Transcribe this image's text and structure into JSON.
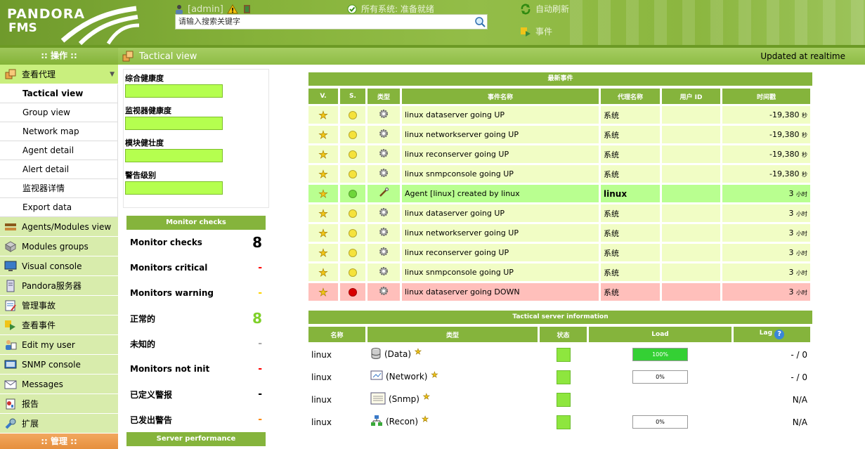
{
  "header": {
    "logo_line1": "PANDORA",
    "logo_line2": "FMS",
    "username": "[admin]",
    "search_placeholder": "请输入搜索关键字",
    "system_status": "所有系统: 准备就绪",
    "auto_refresh": "自动刷新",
    "events": "事件"
  },
  "sidebar": {
    "operation_header": ":: 操作 ::",
    "admin_header": ":: 管理 ::",
    "agents_item": "查看代理",
    "sub_items": [
      "Tactical view",
      "Group view",
      "Network map",
      "Agent detail",
      "Alert detail",
      "监视器详情",
      "Export data"
    ],
    "items": [
      {
        "label": "Agents/Modules view",
        "icon": "agents-modules-icon"
      },
      {
        "label": "Modules groups",
        "icon": "modules-groups-icon"
      },
      {
        "label": "Visual console",
        "icon": "visual-console-icon"
      },
      {
        "label": "Pandora服务器",
        "icon": "server-icon"
      },
      {
        "label": "管理事故",
        "icon": "incidents-icon"
      },
      {
        "label": "查看事件",
        "icon": "events-icon"
      },
      {
        "label": "Edit my user",
        "icon": "user-edit-icon"
      },
      {
        "label": "SNMP console",
        "icon": "snmp-icon"
      },
      {
        "label": "Messages",
        "icon": "mail-icon"
      },
      {
        "label": "报告",
        "icon": "report-icon"
      },
      {
        "label": "扩展",
        "icon": "extensions-icon"
      }
    ]
  },
  "titlebar": {
    "title": "Tactical view",
    "updated": "Updated at realtime"
  },
  "health": {
    "labels": [
      "综合健康度",
      "监视器健康度",
      "模块健壮度",
      "警告级别"
    ]
  },
  "monitors": {
    "title": "Monitor checks",
    "server_performance": "Server performance",
    "rows": [
      {
        "label": "Monitor checks",
        "value": "8",
        "color": "#000000"
      },
      {
        "label": "Monitors critical",
        "value": "-",
        "color": "#ff0000"
      },
      {
        "label": "Monitors warning",
        "value": "-",
        "color": "#ffd400"
      },
      {
        "label": "正常的",
        "value": "8",
        "color": "#7fd02a"
      },
      {
        "label": "未知的",
        "value": "-",
        "color": "#aaaaaa"
      },
      {
        "label": "Monitors not init",
        "value": "-",
        "color": "#ff0000"
      },
      {
        "label": "已定义警报",
        "value": "-",
        "color": "#000000"
      },
      {
        "label": "已发出警告",
        "value": "-",
        "color": "#ff8a00"
      }
    ]
  },
  "events": {
    "title": "最新事件",
    "columns": [
      "V.",
      "S.",
      "类型",
      "事件名称",
      "代理名称",
      "用户 ID",
      "时间戳"
    ],
    "rows": [
      {
        "status": "warn",
        "dot": "#f5e23b",
        "type": "gear",
        "name": "linux dataserver going UP",
        "agent": "系统",
        "user": "",
        "time": "-19,380",
        "unit": "秒"
      },
      {
        "status": "warn",
        "dot": "#f5e23b",
        "type": "gear",
        "name": "linux networkserver going UP",
        "agent": "系统",
        "user": "",
        "time": "-19,380",
        "unit": "秒"
      },
      {
        "status": "warn",
        "dot": "#f5e23b",
        "type": "gear",
        "name": "linux reconserver going UP",
        "agent": "系统",
        "user": "",
        "time": "-19,380",
        "unit": "秒"
      },
      {
        "status": "warn",
        "dot": "#f5e23b",
        "type": "gear",
        "name": "linux snmpconsole going UP",
        "agent": "系统",
        "user": "",
        "time": "-19,380",
        "unit": "秒"
      },
      {
        "status": "ok",
        "dot": "#6fd53a",
        "type": "wand",
        "name": "Agent [linux] created by linux",
        "agent": "linux",
        "user": "",
        "time": "3",
        "unit": "小时"
      },
      {
        "status": "warn",
        "dot": "#f5e23b",
        "type": "gear",
        "name": "linux dataserver going UP",
        "agent": "系统",
        "user": "",
        "time": "3",
        "unit": "小时"
      },
      {
        "status": "warn",
        "dot": "#f5e23b",
        "type": "gear",
        "name": "linux networkserver going UP",
        "agent": "系统",
        "user": "",
        "time": "3",
        "unit": "小时"
      },
      {
        "status": "warn",
        "dot": "#f5e23b",
        "type": "gear",
        "name": "linux reconserver going UP",
        "agent": "系统",
        "user": "",
        "time": "3",
        "unit": "小时"
      },
      {
        "status": "warn",
        "dot": "#f5e23b",
        "type": "gear",
        "name": "linux snmpconsole going UP",
        "agent": "系统",
        "user": "",
        "time": "3",
        "unit": "小时"
      },
      {
        "status": "crit",
        "dot": "#d80000",
        "type": "gear",
        "name": "linux dataserver going DOWN",
        "agent": "系统",
        "user": "",
        "time": "3",
        "unit": "小时"
      }
    ]
  },
  "servers": {
    "title": "Tactical server information",
    "columns": [
      "名称",
      "类型",
      "状态",
      "Load",
      "Lag"
    ],
    "help": "?",
    "rows": [
      {
        "name": "linux",
        "type": "(Data)",
        "icon": "database-icon",
        "load": "100%",
        "load_full": true,
        "show_load": true,
        "lag": "- / 0"
      },
      {
        "name": "linux",
        "type": "(Network)",
        "icon": "network-icon",
        "load": "0%",
        "load_full": false,
        "show_load": true,
        "lag": "- / 0"
      },
      {
        "name": "linux",
        "type": "(Snmp)",
        "icon": "snmp-console-icon",
        "load": "",
        "load_full": false,
        "show_load": false,
        "lag": "N/A"
      },
      {
        "name": "linux",
        "type": "(Recon)",
        "icon": "recon-icon",
        "load": "0%",
        "load_full": false,
        "show_load": true,
        "lag": "N/A"
      }
    ]
  }
}
